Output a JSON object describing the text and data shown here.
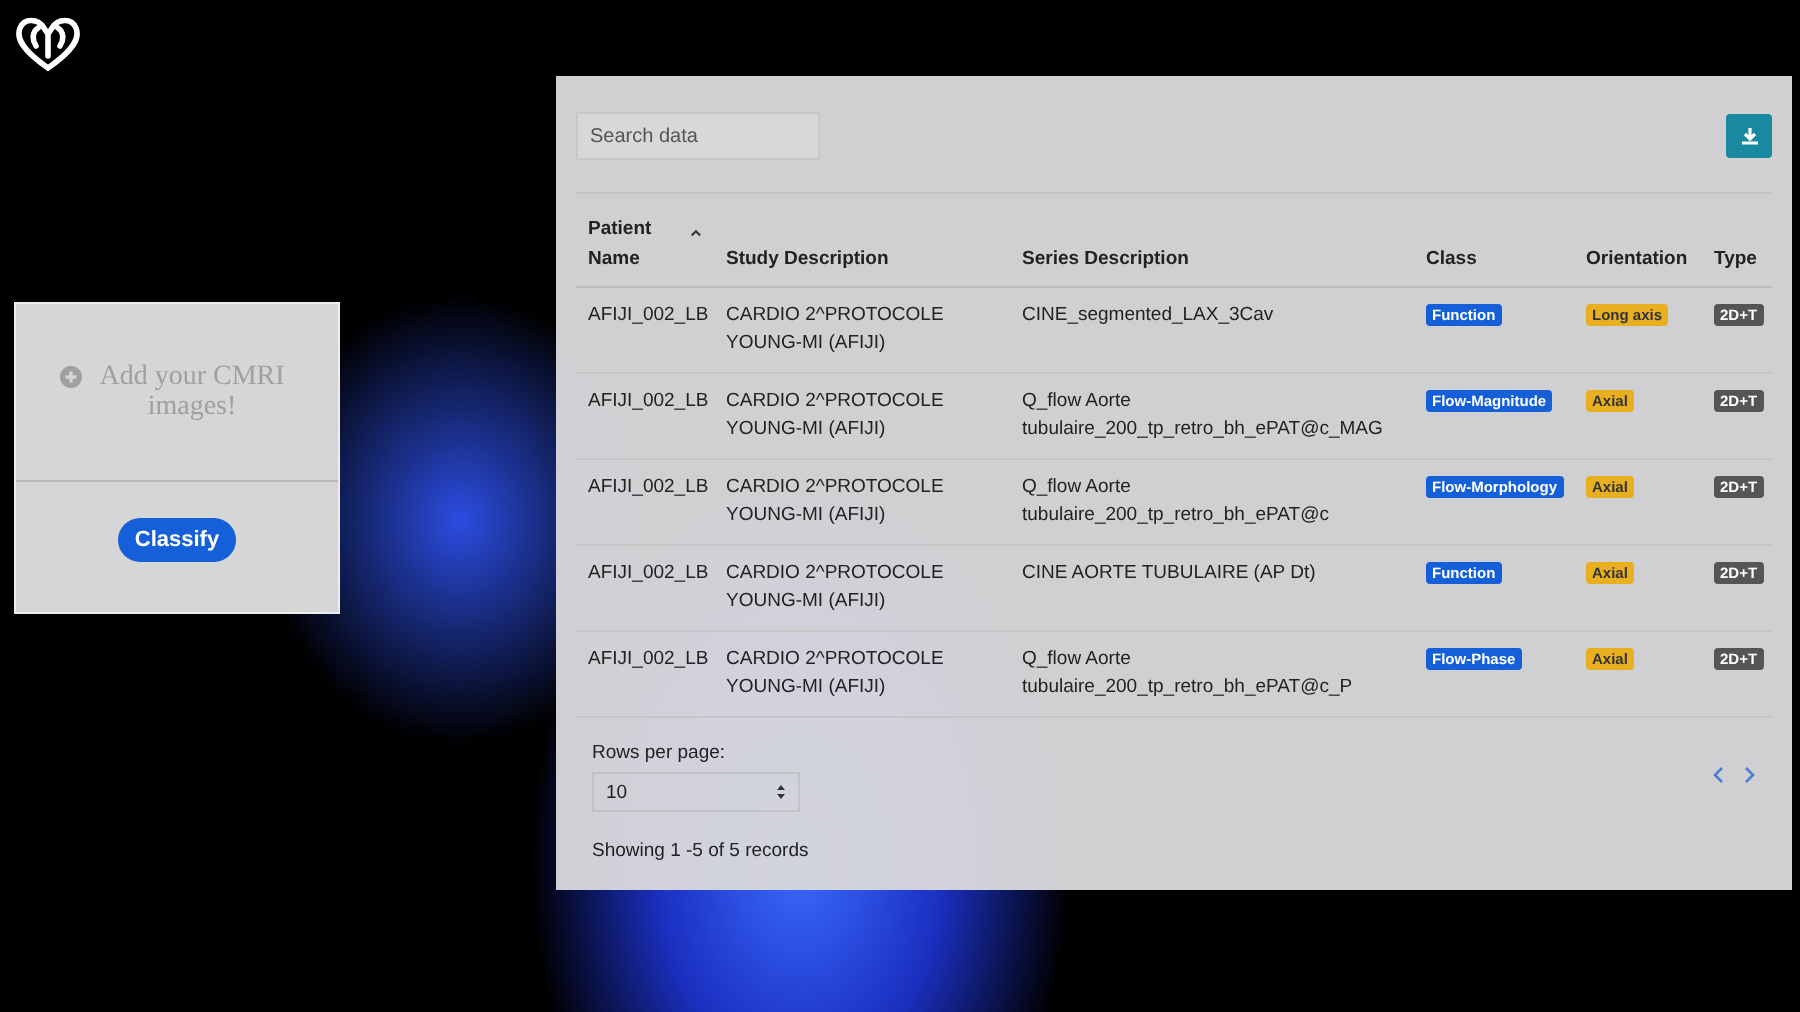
{
  "upload_card": {
    "prompt": "Add your CMRI images!",
    "button": "Classify"
  },
  "table_panel": {
    "search": {
      "placeholder": "Search data"
    },
    "columns": [
      {
        "label": "Patient Name",
        "sorted": true
      },
      {
        "label": "Study Description",
        "sorted": false
      },
      {
        "label": "Series Description",
        "sorted": false
      },
      {
        "label": "Class",
        "sorted": false
      },
      {
        "label": "Orientation",
        "sorted": false
      },
      {
        "label": "Type",
        "sorted": false
      }
    ],
    "rows": [
      {
        "patient": "AFIJI_002_LB",
        "study": "CARDIO 2^PROTOCOLE YOUNG-MI (AFIJI)",
        "series": "CINE_segmented_LAX_3Cav",
        "class": "Function",
        "orientation": "Long axis",
        "type": "2D+T"
      },
      {
        "patient": "AFIJI_002_LB",
        "study": "CARDIO 2^PROTOCOLE YOUNG-MI (AFIJI)",
        "series": "Q_flow Aorte tubulaire_200_tp_retro_bh_ePAT@c_MAG",
        "class": "Flow-Magnitude",
        "orientation": "Axial",
        "type": "2D+T"
      },
      {
        "patient": "AFIJI_002_LB",
        "study": "CARDIO 2^PROTOCOLE YOUNG-MI (AFIJI)",
        "series": "Q_flow Aorte tubulaire_200_tp_retro_bh_ePAT@c",
        "class": "Flow-Morphology",
        "orientation": "Axial",
        "type": "2D+T"
      },
      {
        "patient": "AFIJI_002_LB",
        "study": "CARDIO 2^PROTOCOLE YOUNG-MI (AFIJI)",
        "series": "CINE AORTE TUBULAIRE (AP Dt)",
        "class": "Function",
        "orientation": "Axial",
        "type": "2D+T"
      },
      {
        "patient": "AFIJI_002_LB",
        "study": "CARDIO 2^PROTOCOLE YOUNG-MI (AFIJI)",
        "series": "Q_flow Aorte tubulaire_200_tp_retro_bh_ePAT@c_P",
        "class": "Flow-Phase",
        "orientation": "Axial",
        "type": "2D+T"
      }
    ],
    "rows_per_page": {
      "label": "Rows per page:",
      "value": "10"
    },
    "summary": "Showing 1 -5 of 5 records"
  }
}
